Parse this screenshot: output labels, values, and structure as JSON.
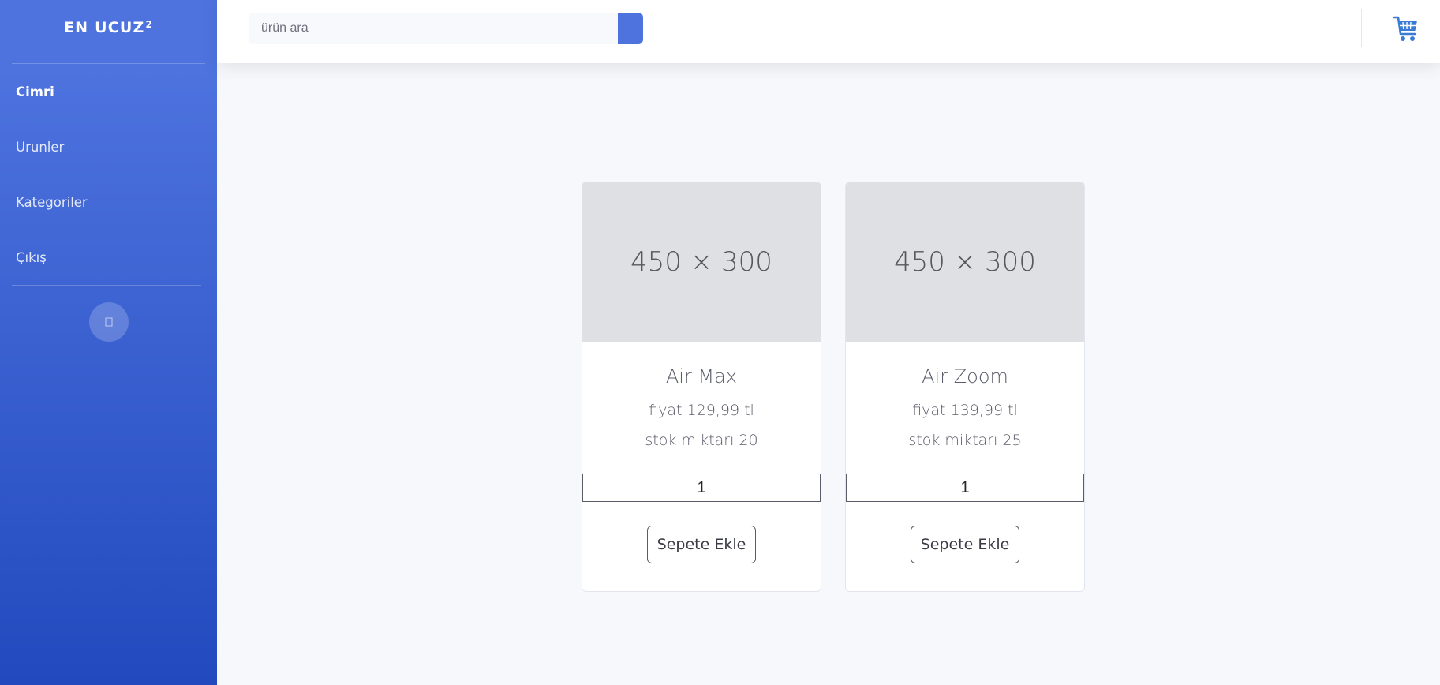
{
  "sidebar": {
    "brand": "EN UCUZ",
    "brand_sup": "2",
    "items": [
      {
        "label": "Cimri",
        "active": true
      },
      {
        "label": "Urunler",
        "active": false
      },
      {
        "label": "Kategoriler",
        "active": false
      },
      {
        "label": "Çıkış",
        "active": false
      }
    ],
    "toggle_icon": "chevron-left-icon"
  },
  "topbar": {
    "search_placeholder": "ürün ara",
    "search_icon": "search-icon",
    "cart_icon": "cart-icon"
  },
  "products": [
    {
      "image_text": "450 × 300",
      "name": "Air Max",
      "price": "fiyat 129,99 tl",
      "stock": "stok miktarı 20",
      "qty": "1",
      "add_label": "Sepete Ekle"
    },
    {
      "image_text": "450 × 300",
      "name": "Air Zoom",
      "price": "fiyat 139,99 tl",
      "stock": "stok miktarı 25",
      "qty": "1",
      "add_label": "Sepete Ekle"
    }
  ],
  "colors": {
    "primary": "#4e73df",
    "sidebar_bottom": "#224abe",
    "page_bg": "#f7f8fc",
    "cart": "#3a7bd5"
  }
}
